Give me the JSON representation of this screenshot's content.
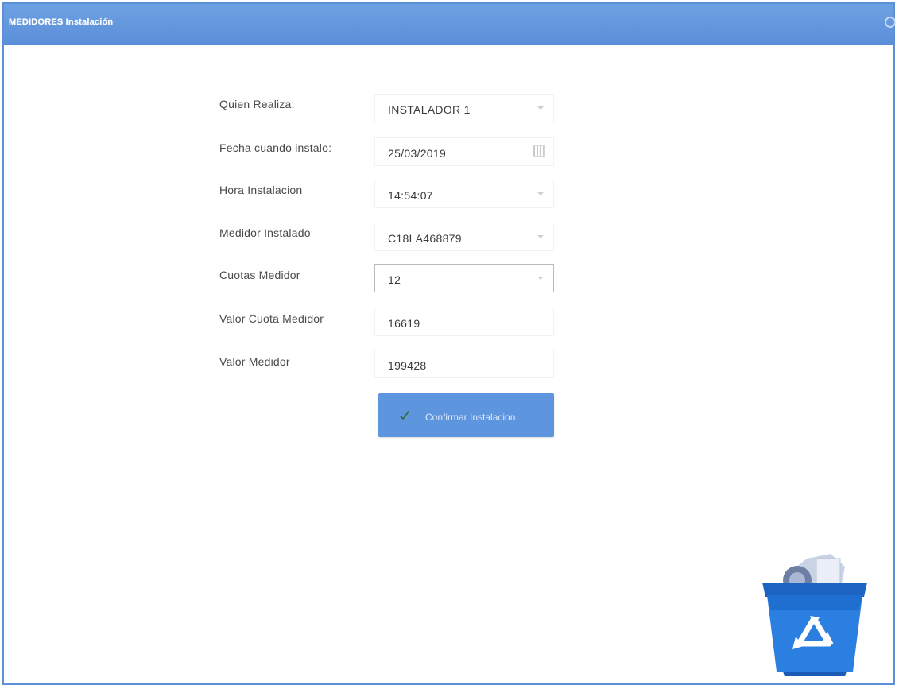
{
  "window": {
    "title": "MEDIDORES Instalación"
  },
  "form": {
    "fields": [
      {
        "label": "Quien Realiza:",
        "value": "INSTALADOR 1",
        "control": "dropdown"
      },
      {
        "label": "Fecha cuando instalo:",
        "value": "25/03/2019",
        "control": "date"
      },
      {
        "label": "Hora Instalacion",
        "value": "14:54:07",
        "control": "dropdown"
      },
      {
        "label": "Medidor Instalado",
        "value": "C18LA468879",
        "control": "dropdown"
      },
      {
        "label": "Cuotas Medidor",
        "value": "12",
        "control": "dropdown"
      },
      {
        "label": "Valor Cuota Medidor",
        "value": "16619",
        "control": "text"
      },
      {
        "label": "Valor Medidor",
        "value": "199428",
        "control": "text"
      }
    ],
    "confirm_label": "Confirmar Instalacion"
  },
  "icons": {
    "close": "close-icon",
    "dropdown": "chevron-down-icon",
    "calendar": "calendar-icon",
    "confirm": "checkmark-icon",
    "recycle_bin": "recycle-bin-icon"
  },
  "colors": {
    "titlebar": "#5a8ed8",
    "accent": "#5e95df",
    "bin": "#1f6fd1"
  }
}
